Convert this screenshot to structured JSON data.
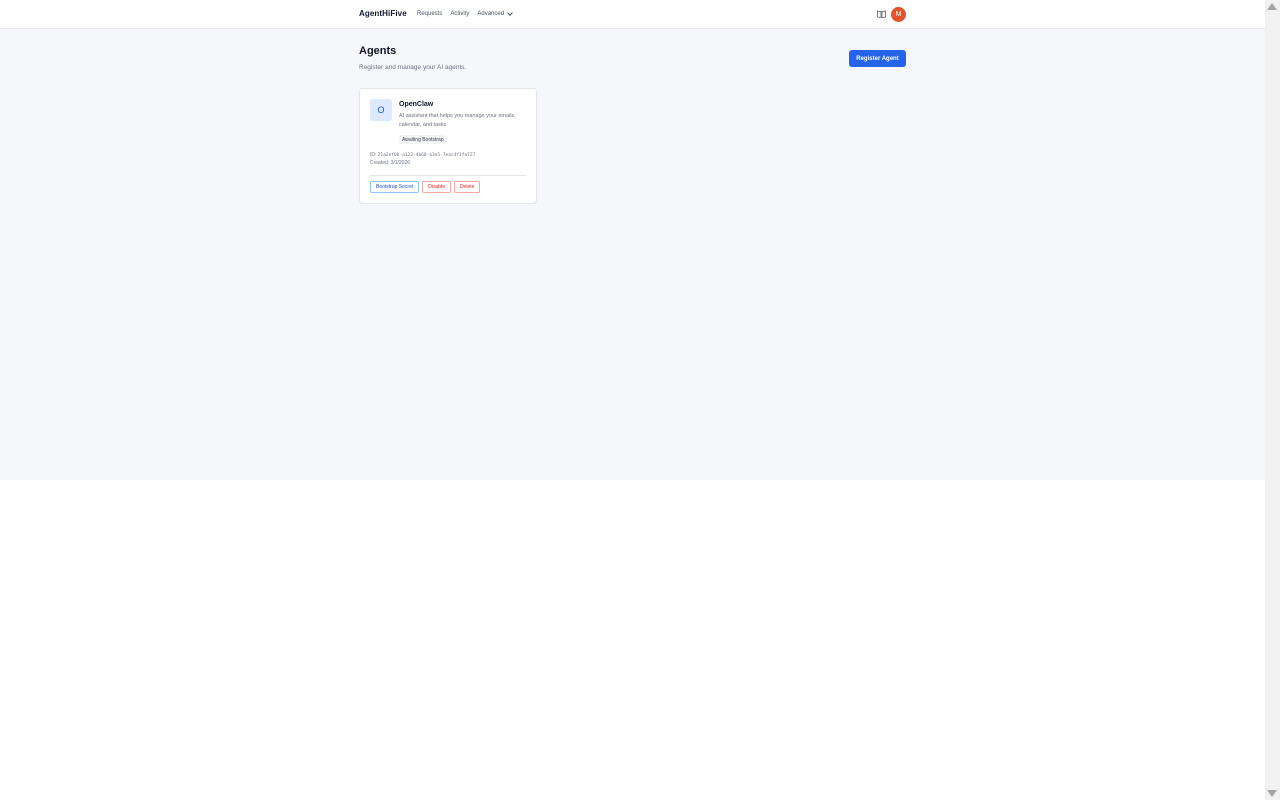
{
  "header": {
    "brand": "AgentHiFive",
    "nav": [
      {
        "label": "Requests"
      },
      {
        "label": "Activity"
      },
      {
        "label": "Advanced"
      }
    ],
    "docs_icon": "book-icon",
    "avatar_initial": "M"
  },
  "page": {
    "title": "Agents",
    "subtitle": "Register and manage your AI agents.",
    "register_label": "Register Agent"
  },
  "agents": [
    {
      "initial": "O",
      "name": "OpenClaw",
      "description": "AI assistant that helps you manage your emails, calendar, and tasks",
      "status": "Awaiting Bootstrap",
      "id_label": "ID:",
      "id": "21a2ef0b-a122-4b68-a3e5-7eac4f1fe727",
      "created": "Created: 3/1/2026",
      "actions": {
        "bootstrap": "Bootstrap Secret",
        "disable": "Disable",
        "delete": "Delete"
      }
    }
  ],
  "colors": {
    "primary": "#2563eb",
    "danger": "#dc2626",
    "avatar": "#e2542c",
    "background": "#f5f7fa"
  }
}
